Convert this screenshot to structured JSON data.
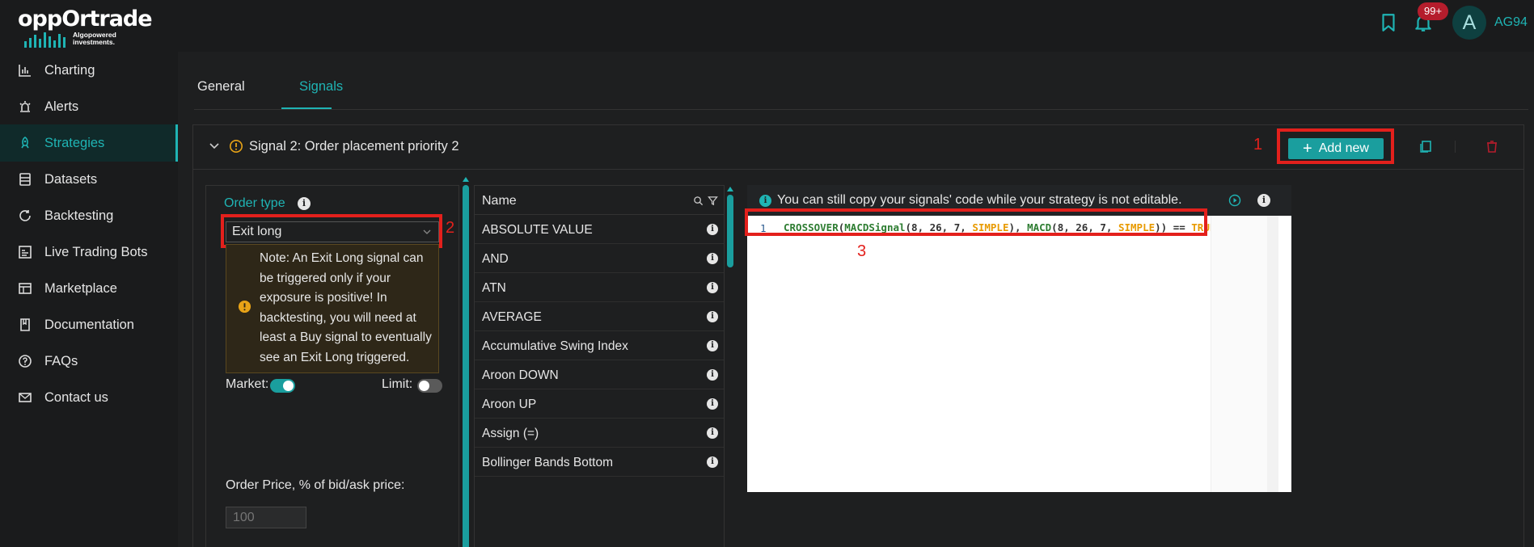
{
  "app": {
    "logo_text": "oppOrtrade",
    "logo_tagline_1": "Algopowered",
    "logo_tagline_2": "investments."
  },
  "header": {
    "notification_count": "99+",
    "avatar_initial": "A",
    "username": "AG94"
  },
  "sidebar": {
    "items": [
      {
        "label": "Charting",
        "icon": "bar-chart-icon",
        "active": false
      },
      {
        "label": "Alerts",
        "icon": "alarm-icon",
        "active": false
      },
      {
        "label": "Strategies",
        "icon": "rocket-icon",
        "active": true
      },
      {
        "label": "Datasets",
        "icon": "database-icon",
        "active": false
      },
      {
        "label": "Backtesting",
        "icon": "refresh-icon",
        "active": false
      },
      {
        "label": "Live Trading Bots",
        "icon": "bot-icon",
        "active": false
      },
      {
        "label": "Marketplace",
        "icon": "store-icon",
        "active": false
      },
      {
        "label": "Documentation",
        "icon": "book-icon",
        "active": false
      },
      {
        "label": "FAQs",
        "icon": "question-icon",
        "active": false
      },
      {
        "label": "Contact us",
        "icon": "mail-icon",
        "active": false
      }
    ]
  },
  "tabs": [
    {
      "label": "General",
      "active": false
    },
    {
      "label": "Signals",
      "active": true
    }
  ],
  "signal": {
    "title": "Signal 2: Order placement priority 2",
    "add_new_label": "Add new"
  },
  "annotations": {
    "one": "1",
    "two": "2",
    "three": "3"
  },
  "form": {
    "order_type_label": "Order type",
    "order_type_value": "Exit long",
    "note": "Note: An Exit Long signal can be triggered only if your exposure is positive! In backtesting, you will need at least a Buy signal to eventually see an Exit Long triggered.",
    "market_label": "Market:",
    "market_on": true,
    "limit_label": "Limit:",
    "limit_on": false,
    "order_price_label": "Order Price, % of bid/ask price:",
    "order_price_placeholder": "100"
  },
  "functions": {
    "header": "Name",
    "items": [
      "ABSOLUTE VALUE",
      "AND",
      "ATN",
      "AVERAGE",
      "Accumulative Swing Index",
      "Aroon DOWN",
      "Aroon UP",
      "Assign (=)",
      "Bollinger Bands Bottom"
    ]
  },
  "editor": {
    "banner": "You can still copy your signals' code while your strategy is not editable.",
    "line_number": "1",
    "code": {
      "t1": "CROSSOVER",
      "t2": "(",
      "t3": "MACDSignal",
      "t4": "(8, 26, 7, ",
      "t5": "SIMPLE",
      "t6": "), ",
      "t7": "MACD",
      "t8": "(8, 26, 7, ",
      "t9": "SIMPLE",
      "t10": ")) == ",
      "t11": "TRUE"
    }
  },
  "colors": {
    "accent": "#1fb4b4",
    "annotation": "#e3201c",
    "warning": "#e8a317"
  }
}
